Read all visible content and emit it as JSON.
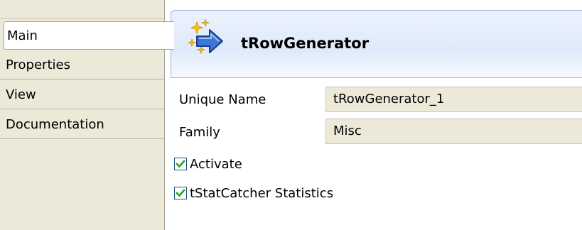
{
  "tabs": [
    {
      "label": "Main",
      "selected": true
    },
    {
      "label": "Properties",
      "selected": false
    },
    {
      "label": "View",
      "selected": false
    },
    {
      "label": "Documentation",
      "selected": false
    }
  ],
  "header": {
    "icon": "component-arrow-sparkle-icon",
    "title": "tRowGenerator"
  },
  "form": {
    "unique_name": {
      "label": "Unique Name",
      "value": "tRowGenerator_1"
    },
    "family": {
      "label": "Family",
      "value": "Misc"
    },
    "activate": {
      "label": "Activate",
      "checked": true
    },
    "stats": {
      "label": "tStatCatcher Statistics",
      "checked": true
    }
  },
  "colors": {
    "panel_background": "#ece9d8",
    "header_border": "#9db2d8",
    "checkbox_check": "#21a121"
  }
}
